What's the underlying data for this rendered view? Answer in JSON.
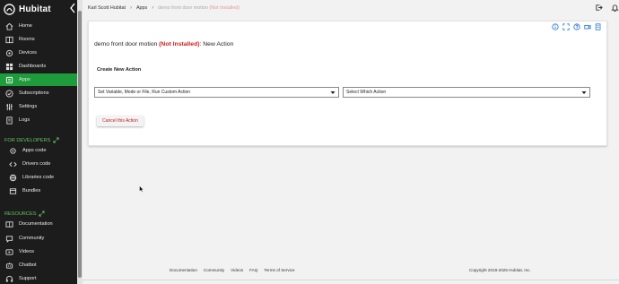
{
  "brand": {
    "name": "Hubitat",
    "logo_icon": "hubitat-logo-icon",
    "accent": "#1e9b3a"
  },
  "sidebar": {
    "items": [
      {
        "label": "Home",
        "icon": "home-icon",
        "active": false
      },
      {
        "label": "Rooms",
        "icon": "rooms-icon",
        "active": false
      },
      {
        "label": "Devices",
        "icon": "devices-icon",
        "active": false
      },
      {
        "label": "Dashboards",
        "icon": "dashboard-icon",
        "active": false
      },
      {
        "label": "Apps",
        "icon": "apps-icon",
        "active": true
      },
      {
        "label": "Subscriptions",
        "icon": "check-circle-icon",
        "active": false
      },
      {
        "label": "Settings",
        "icon": "settings-sliders-icon",
        "active": false
      },
      {
        "label": "Logs",
        "icon": "logs-icon",
        "active": false
      }
    ],
    "developer_section": {
      "title": "FOR DEVELOPERS",
      "items": [
        {
          "label": "Apps code",
          "icon": "apps-code-icon"
        },
        {
          "label": "Drivers code",
          "icon": "code-icon"
        },
        {
          "label": "Libraries code",
          "icon": "libraries-icon"
        },
        {
          "label": "Bundles",
          "icon": "bundles-icon"
        }
      ]
    },
    "resources_section": {
      "title": "RESOURCES",
      "items": [
        {
          "label": "Documentation",
          "icon": "documentation-icon"
        },
        {
          "label": "Community",
          "icon": "community-icon"
        },
        {
          "label": "Videos",
          "icon": "video-icon"
        },
        {
          "label": "Chatbot",
          "icon": "chatbot-icon"
        },
        {
          "label": "Support",
          "icon": "support-icon"
        }
      ]
    }
  },
  "breadcrumb": {
    "hub": "Karl Scott Hubitat",
    "apps": "Apps",
    "current_name": "demo front door motion",
    "current_status": "(Not Installed)"
  },
  "header_icons": [
    "logout-icon",
    "bell-icon"
  ],
  "card_icons": [
    "info-icon",
    "fullscreen-icon",
    "help-icon",
    "video-camera-icon",
    "documentation-icon"
  ],
  "page": {
    "title_name": "demo front door motion",
    "title_status": "(Not Installed)",
    "title_suffix": ": New Action",
    "section_heading": "Create New Action",
    "action_select_value": "Set Variable, Mode or File, Run Custom Action",
    "which_select_value": "Select Which Action",
    "cancel_label": "Cancel this Action"
  },
  "footer": {
    "links": [
      "Documentation",
      "Community",
      "Videos",
      "FAQ",
      "Terms of Service"
    ],
    "copyright": "Copyright 2018-2025 Hubitat, Inc."
  },
  "colors": {
    "sidebar_bg": "#1c1c1c",
    "active": "#1e9b3a",
    "not_installed": "#cc1d1d",
    "section_title": "#65c464",
    "header_icon": "#1a6fd4"
  }
}
